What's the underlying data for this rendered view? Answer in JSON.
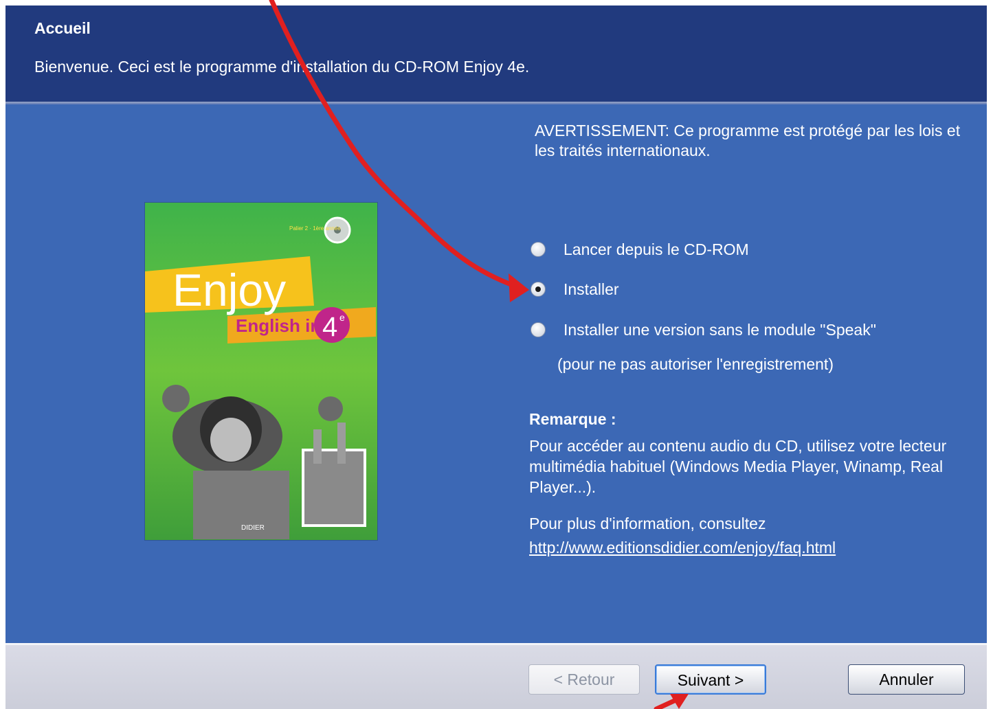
{
  "header": {
    "title": "Accueil",
    "subtitle": "Bienvenue. Ceci est le programme d'installation du CD-ROM Enjoy 4e."
  },
  "cover": {
    "title": "Enjoy",
    "subtitle": "English in",
    "level": "4",
    "level_sup": "e",
    "tagline": "Palier 2 · 1ère année",
    "publisher": "DIDIER"
  },
  "warning": "AVERTISSEMENT: Ce programme est protégé par les lois et les traités internationaux.",
  "options": [
    {
      "label": "Lancer depuis le CD-ROM",
      "checked": false
    },
    {
      "label": "Installer",
      "checked": true
    },
    {
      "label": "Installer une version sans le module \"Speak\"",
      "checked": false
    }
  ],
  "option_note": "(pour ne pas autoriser l'enregistrement)",
  "remark": {
    "title": "Remarque :",
    "body": "Pour accéder au contenu audio du CD, utilisez votre lecteur multimédia habituel (Windows Media Player, Winamp, Real Player...)."
  },
  "info": {
    "text": "Pour plus d'information, consultez",
    "link": "http://www.editionsdidier.com/enjoy/faq.html"
  },
  "buttons": {
    "back": "< Retour",
    "next": "Suivant >",
    "cancel": "Annuler"
  },
  "colors": {
    "header_bg": "#213a7e",
    "body_bg": "#3c68b5",
    "annotation_arrow": "#e02020"
  }
}
